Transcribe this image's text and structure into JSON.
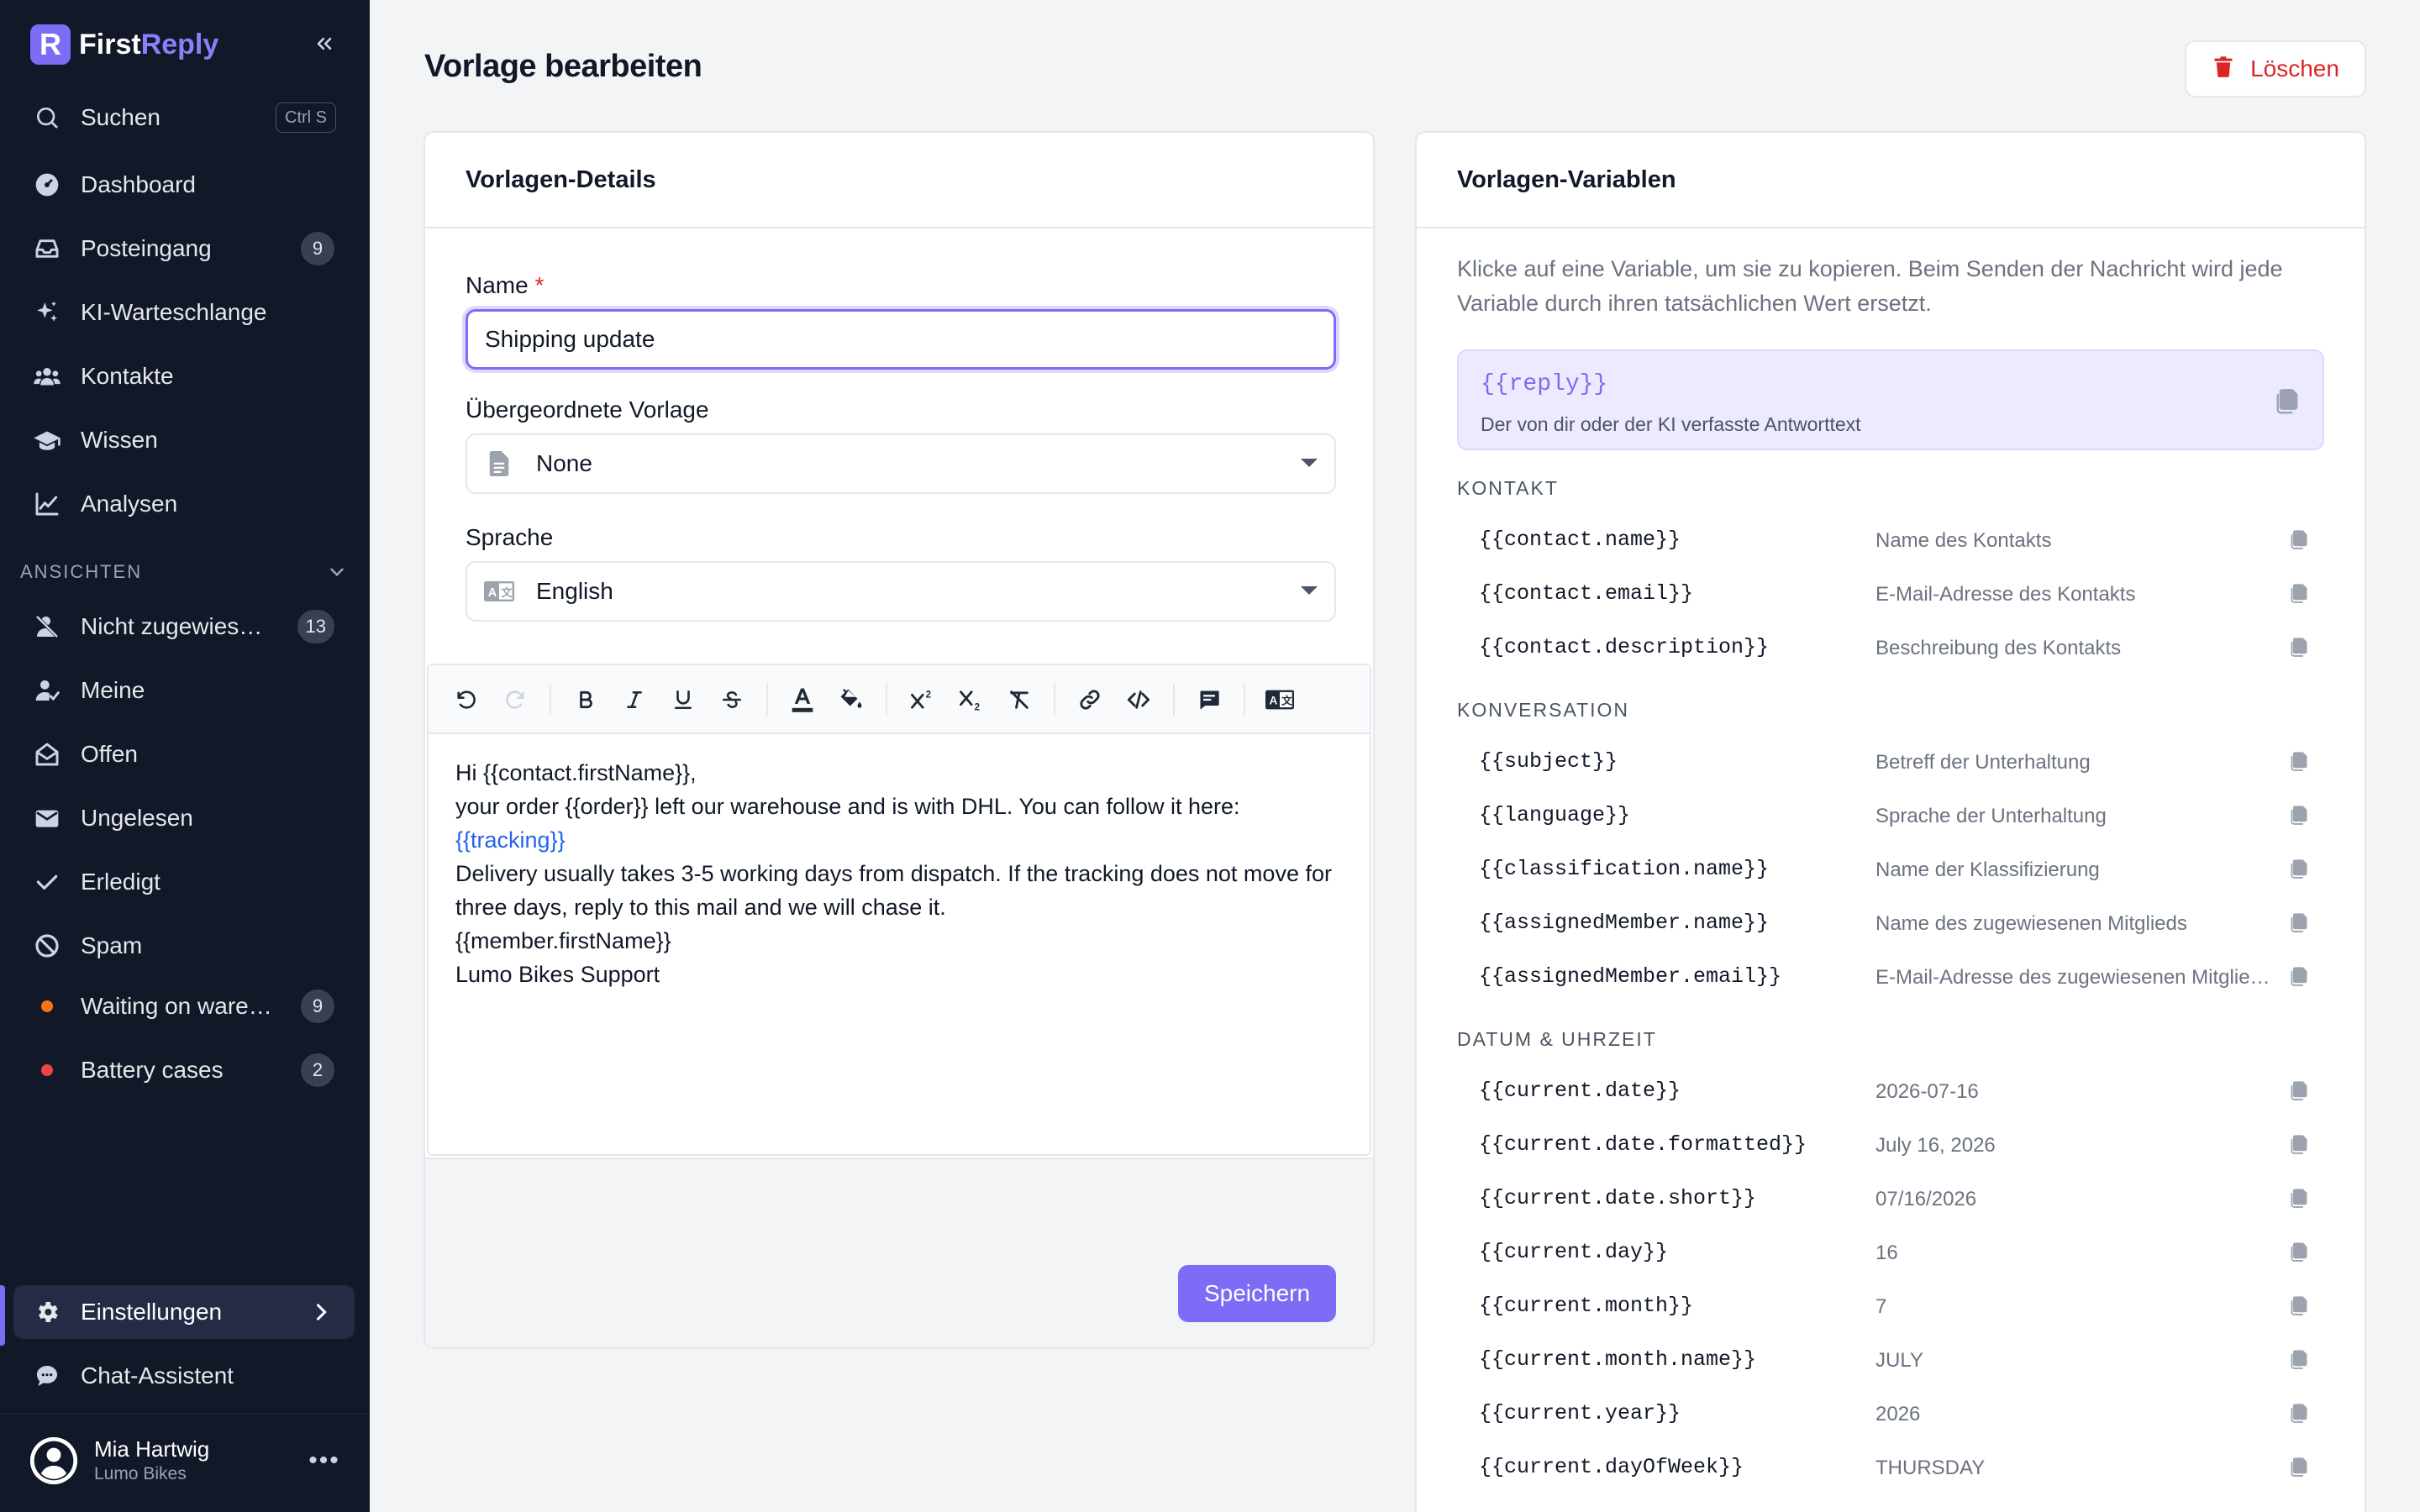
{
  "app": {
    "logo_letter": "R",
    "name_a": "First",
    "name_b": "Reply"
  },
  "sidebar": {
    "search": {
      "label": "Suchen",
      "shortcut": "Ctrl S"
    },
    "items": [
      {
        "label": "Dashboard",
        "icon": "dashboard-icon"
      },
      {
        "label": "Posteingang",
        "icon": "inbox-icon",
        "badge": "9"
      },
      {
        "label": "KI-Warteschlange",
        "icon": "sparkle-icon"
      },
      {
        "label": "Kontakte",
        "icon": "contacts-icon"
      },
      {
        "label": "Wissen",
        "icon": "knowledge-icon"
      },
      {
        "label": "Analysen",
        "icon": "analytics-icon"
      }
    ],
    "section_label": "ANSICHTEN",
    "views": [
      {
        "label": "Nicht zugewies…",
        "icon": "unassigned-icon",
        "badge": "13"
      },
      {
        "label": "Meine",
        "icon": "mine-icon"
      },
      {
        "label": "Offen",
        "icon": "open-icon"
      },
      {
        "label": "Ungelesen",
        "icon": "unread-icon"
      },
      {
        "label": "Erledigt",
        "icon": "done-icon"
      },
      {
        "label": "Spam",
        "icon": "spam-icon"
      },
      {
        "label": "Waiting on ware…",
        "icon": "orange-dot",
        "badge": "9",
        "color": "#f97316"
      },
      {
        "label": "Battery cases",
        "icon": "red-dot",
        "badge": "2",
        "color": "#ef4444"
      }
    ],
    "settings": {
      "label": "Einstellungen"
    },
    "chat": {
      "label": "Chat-Assistent"
    },
    "user": {
      "name": "Mia Hartwig",
      "org": "Lumo Bikes"
    }
  },
  "page": {
    "title": "Vorlage bearbeiten",
    "delete_label": "Löschen"
  },
  "details": {
    "title": "Vorlagen-Details",
    "name_label": "Name",
    "required_mark": "*",
    "name_value": "Shipping update",
    "parent_label": "Übergeordnete Vorlage",
    "parent_value": "None",
    "language_label": "Sprache",
    "language_value": "English",
    "body": {
      "line1": "Hi {{contact.firstName}},",
      "line2": "your order {{order}} left our warehouse and is with DHL. You can follow it here:",
      "line3_link": "{{tracking}}",
      "line4": "Delivery usually takes 3-5 working days from dispatch. If the tracking does not move for three days, reply to this mail and we will chase it.",
      "line5": "{{member.firstName}}",
      "line6": "Lumo Bikes Support"
    },
    "save_label": "Speichern"
  },
  "variables": {
    "title": "Vorlagen-Variablen",
    "helper": "Klicke auf eine Variable, um sie zu kopieren. Beim Senden der Nachricht wird jede Variable durch ihren tatsächlichen Wert ersetzt.",
    "reply": {
      "code": "{{reply}}",
      "desc": "Der von dir oder der KI verfasste Antworttext"
    },
    "groups": [
      {
        "label": "KONTAKT",
        "rows": [
          {
            "code": "{{contact.name}}",
            "desc": "Name des Kontakts"
          },
          {
            "code": "{{contact.email}}",
            "desc": "E-Mail-Adresse des Kontakts"
          },
          {
            "code": "{{contact.description}}",
            "desc": "Beschreibung des Kontakts"
          }
        ]
      },
      {
        "label": "KONVERSATION",
        "rows": [
          {
            "code": "{{subject}}",
            "desc": "Betreff der Unterhaltung"
          },
          {
            "code": "{{language}}",
            "desc": "Sprache der Unterhaltung"
          },
          {
            "code": "{{classification.name}}",
            "desc": "Name der Klassifizierung"
          },
          {
            "code": "{{assignedMember.name}}",
            "desc": "Name des zugewiesenen Mitglieds"
          },
          {
            "code": "{{assignedMember.email}}",
            "desc": "E-Mail-Adresse des zugewiesenen Mitglieds"
          }
        ]
      },
      {
        "label": "DATUM & UHRZEIT",
        "rows": [
          {
            "code": "{{current.date}}",
            "desc": "2026-07-16"
          },
          {
            "code": "{{current.date.formatted}}",
            "desc": "July 16, 2026"
          },
          {
            "code": "{{current.date.short}}",
            "desc": "07/16/2026"
          },
          {
            "code": "{{current.day}}",
            "desc": "16"
          },
          {
            "code": "{{current.month}}",
            "desc": "7"
          },
          {
            "code": "{{current.month.name}}",
            "desc": "JULY"
          },
          {
            "code": "{{current.year}}",
            "desc": "2026"
          },
          {
            "code": "{{current.dayOfWeek}}",
            "desc": "THURSDAY"
          }
        ]
      }
    ]
  },
  "colors": {
    "accent": "#7c6cf6",
    "sidebar_bg": "#111827",
    "danger": "#dc2626"
  }
}
